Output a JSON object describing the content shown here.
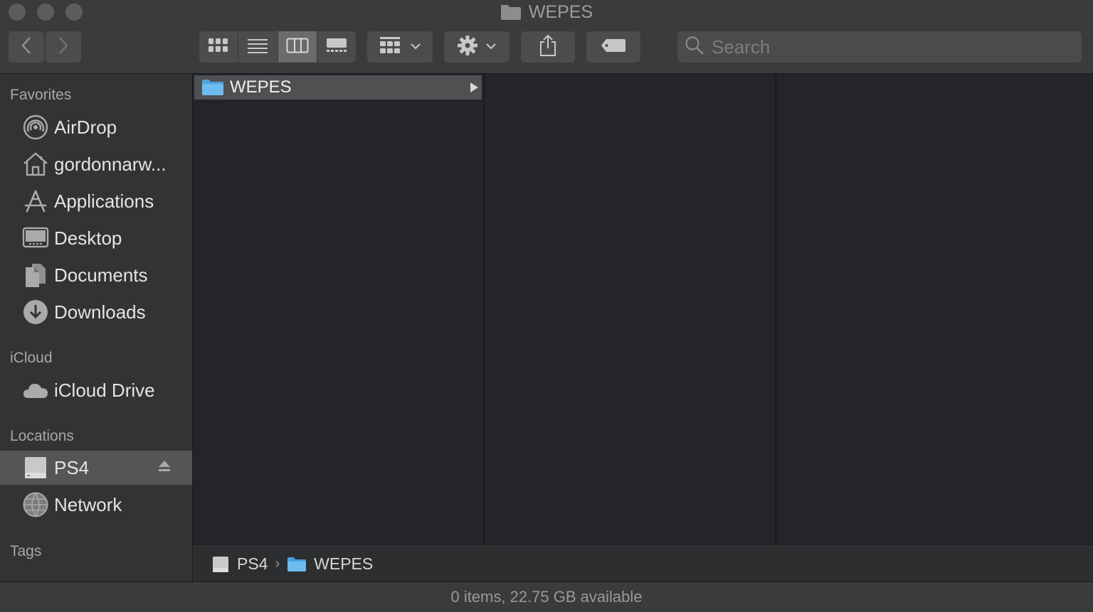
{
  "window": {
    "title": "WEPES"
  },
  "toolbar": {
    "search_placeholder": "Search"
  },
  "sidebar": {
    "favorites_heading": "Favorites",
    "favorites": [
      {
        "label": "AirDrop",
        "icon": "airdrop-icon"
      },
      {
        "label": "gordonnarw...",
        "icon": "home-icon"
      },
      {
        "label": "Applications",
        "icon": "applications-icon"
      },
      {
        "label": "Desktop",
        "icon": "desktop-icon"
      },
      {
        "label": "Documents",
        "icon": "documents-icon"
      },
      {
        "label": "Downloads",
        "icon": "downloads-icon"
      }
    ],
    "icloud_heading": "iCloud",
    "icloud": [
      {
        "label": "iCloud Drive",
        "icon": "cloud-icon"
      }
    ],
    "locations_heading": "Locations",
    "locations": [
      {
        "label": "PS4",
        "icon": "drive-icon",
        "selected": true
      },
      {
        "label": "Network",
        "icon": "network-icon"
      }
    ],
    "tags_heading": "Tags"
  },
  "browser": {
    "column1": [
      {
        "label": "WEPES",
        "icon": "folder-icon",
        "selected": true
      }
    ]
  },
  "pathbar": {
    "items": [
      "PS4",
      "WEPES"
    ]
  },
  "status": {
    "text": "0 items, 22.75 GB available"
  },
  "colors": {
    "folder_blue": "#5fb4e9",
    "selection": "#545557"
  }
}
